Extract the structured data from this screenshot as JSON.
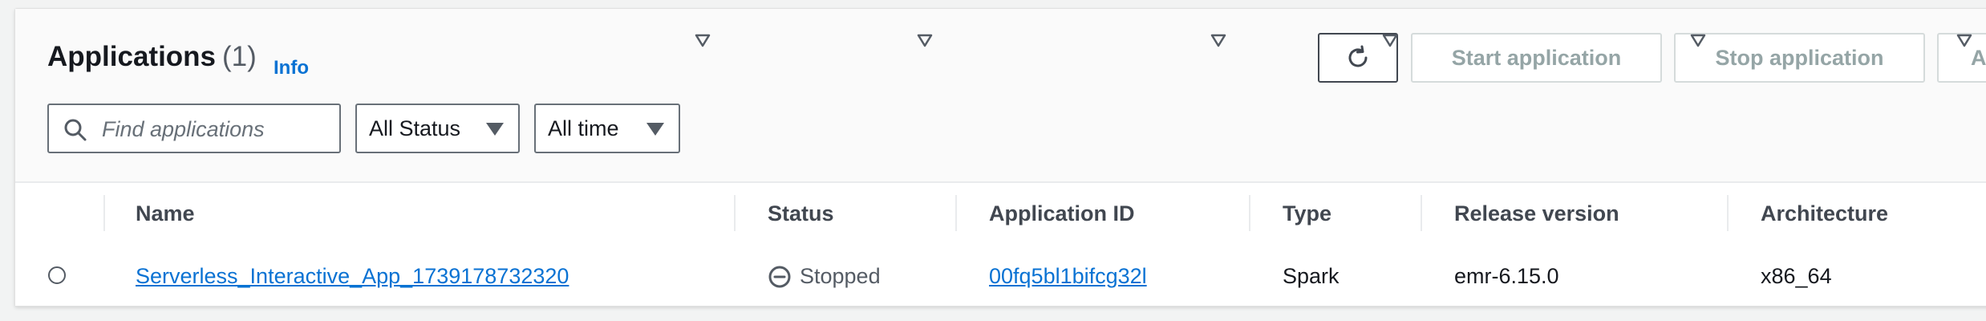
{
  "header": {
    "title": "Applications",
    "count": "(1)",
    "info_link": "Info"
  },
  "actions": {
    "refresh_icon": "refresh-icon",
    "start_label": "Start application",
    "stop_label": "Stop application",
    "extra_label": "A"
  },
  "filters": {
    "search_placeholder": "Find applications",
    "search_value": "",
    "status_selected": "All Status",
    "time_selected": "All time"
  },
  "table": {
    "columns": [
      "Name",
      "Status",
      "Application ID",
      "Type",
      "Release version",
      "Architecture"
    ],
    "rows": [
      {
        "name": "Serverless_Interactive_App_1739178732320",
        "status": "Stopped",
        "application_id": "00fq5bl1bifcg32l",
        "type": "Spark",
        "release_version": "emr-6.15.0",
        "architecture": "x86_64"
      }
    ]
  },
  "colors": {
    "link": "#0972d3",
    "text": "#16191f",
    "muted": "#545b64",
    "disabled": "#95a5a6"
  }
}
